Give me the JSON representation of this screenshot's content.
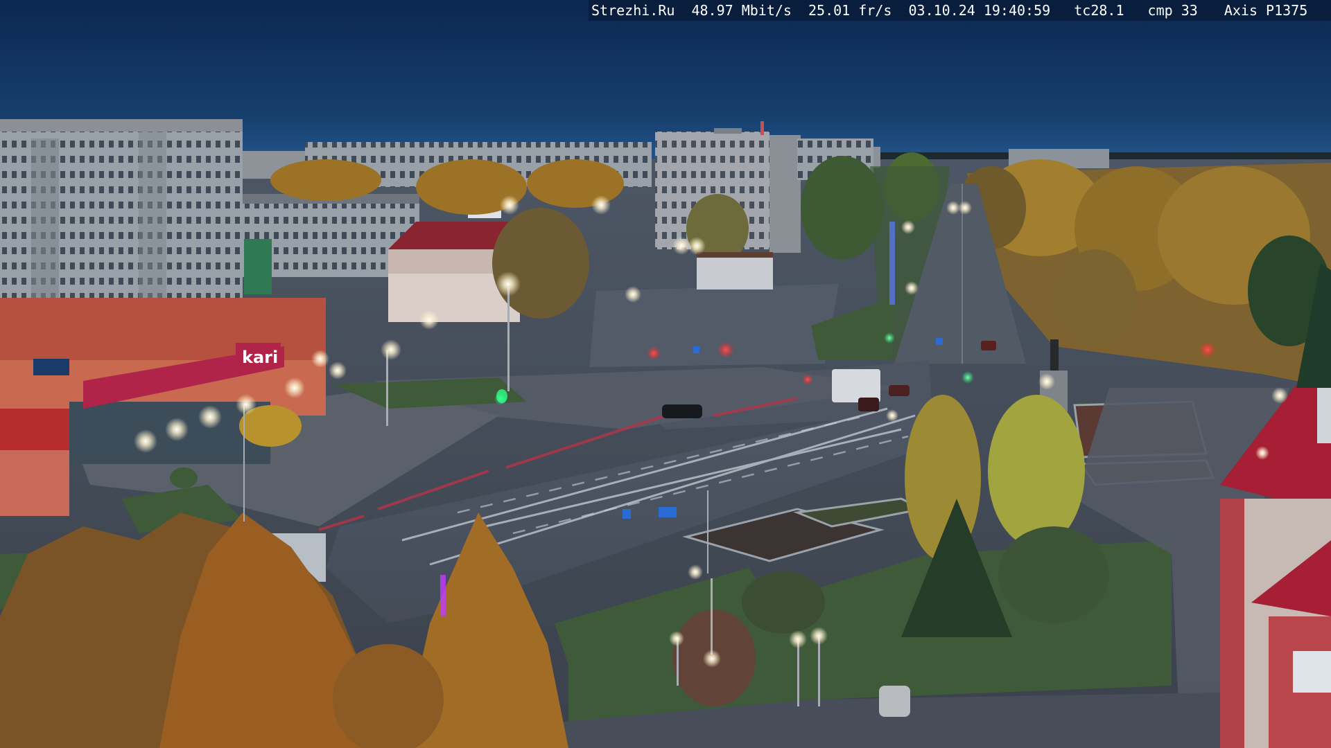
{
  "overlay": {
    "site": "Strezhi.Ru",
    "bitrate": "48.97 Mbit/s",
    "framerate": "25.01 fr/s",
    "datetime": "03.10.24 19:40:59",
    "tc": "tc28.1",
    "cmp": "cmp 33",
    "camera": "Axis P1375"
  },
  "signs": {
    "store": "kari"
  },
  "colors": {
    "sky_top": "#0c2a52",
    "sky_horizon": "#1e4f86",
    "foliage": "#b8862a",
    "lamp": "#fff6dc"
  }
}
